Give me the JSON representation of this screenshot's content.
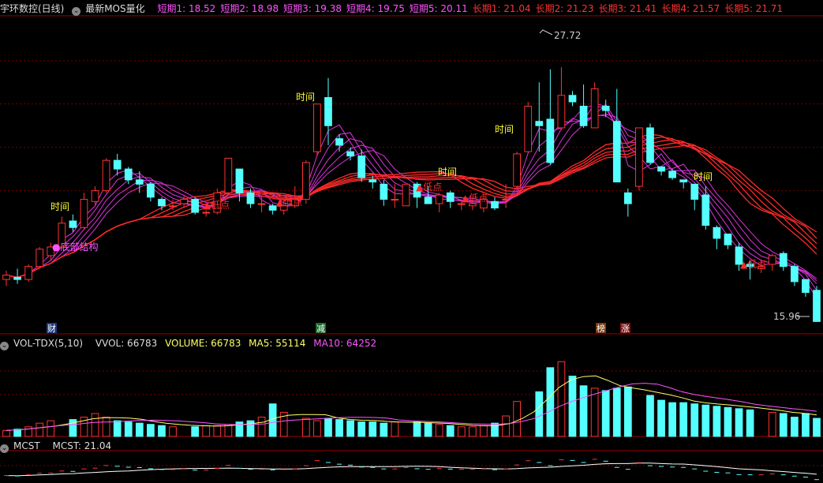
{
  "header": {
    "stock_name": "宇环数控(日线)",
    "indicator_name": "最新MOS量化",
    "ma_labels": [
      {
        "text": "短期1: 18.52",
        "color": "#ff55ff"
      },
      {
        "text": "短期2: 18.98",
        "color": "#ff55ff"
      },
      {
        "text": "短期3: 19.38",
        "color": "#ff55ff"
      },
      {
        "text": "短期4: 19.75",
        "color": "#ff55ff"
      },
      {
        "text": "短期5: 20.11",
        "color": "#ff55ff"
      },
      {
        "text": "长期1: 21.04",
        "color": "#ff3333"
      },
      {
        "text": "长期2: 21.23",
        "color": "#ff3333"
      },
      {
        "text": "长期3: 21.41",
        "color": "#ff3333"
      },
      {
        "text": "长期4: 21.57",
        "color": "#ff3333"
      },
      {
        "text": "长期5: 21.71",
        "color": "#ff3333"
      }
    ]
  },
  "vol_header": {
    "name": "VOL-TDX(5,10)",
    "vvol": "VVOL: 66783",
    "volume": "VOLUME: 66783",
    "ma5": "MA5: 55114",
    "ma10": "MA10: 64252"
  },
  "mcst_header": {
    "name": "MCST",
    "value": "MCST: 21.04"
  },
  "annotations": {
    "high_price": "27.72",
    "low_price": "15.96",
    "time_label": "时间",
    "low_point_label": "▲低点",
    "bottom_structure_label": "●底部结构",
    "tags": [
      {
        "text": "财",
        "bg": "#1a3a7a",
        "color": "#ffffff"
      },
      {
        "text": "减",
        "bg": "#1a6a2a",
        "color": "#ffffff"
      },
      {
        "text": "榜",
        "bg": "#7a3a10",
        "color": "#ffffff"
      },
      {
        "text": "涨",
        "bg": "#7a1010",
        "color": "#ffffff"
      }
    ]
  },
  "colors": {
    "up": "#ff3333",
    "down": "#54ffff",
    "short_ma": "#dd33dd",
    "long_ma": "#ff2a2a",
    "vol_ma5": "#ffff66",
    "vol_ma10": "#ff55ff",
    "grid": "#7a0000",
    "time_text": "#ffff33",
    "low_text": "#ff2a2a"
  },
  "chart_data": {
    "type": "candlestick",
    "ylim": [
      15.5,
      30
    ],
    "candles": [
      [
        17.9,
        18.1,
        17.6,
        18.3
      ],
      [
        18.0,
        17.9,
        17.7,
        18.4
      ],
      [
        17.9,
        18.5,
        17.8,
        18.6
      ],
      [
        18.5,
        19.3,
        18.4,
        19.4
      ],
      [
        19.0,
        19.4,
        18.8,
        19.6
      ],
      [
        19.4,
        20.5,
        19.3,
        20.8
      ],
      [
        20.6,
        20.3,
        20.1,
        20.9
      ],
      [
        20.3,
        21.6,
        20.2,
        21.9
      ],
      [
        21.5,
        22.0,
        21.3,
        22.2
      ],
      [
        22.0,
        23.4,
        21.9,
        23.5
      ],
      [
        23.4,
        23.0,
        22.7,
        23.7
      ],
      [
        23.0,
        22.5,
        22.3,
        23.1
      ],
      [
        22.5,
        22.3,
        21.9,
        22.9
      ],
      [
        22.3,
        21.7,
        21.5,
        22.4
      ],
      [
        21.6,
        21.3,
        21.1,
        21.7
      ],
      [
        21.3,
        21.3,
        21.1,
        21.6
      ],
      [
        21.4,
        21.6,
        21.2,
        21.8
      ],
      [
        21.6,
        21.0,
        20.9,
        21.7
      ],
      [
        21.0,
        21.0,
        20.8,
        21.1
      ],
      [
        21.0,
        21.9,
        20.9,
        22.1
      ],
      [
        21.9,
        23.5,
        21.8,
        23.5
      ],
      [
        23.0,
        21.9,
        21.5,
        23.0
      ],
      [
        21.9,
        21.4,
        21.2,
        22.1
      ],
      [
        21.4,
        21.4,
        21.0,
        21.7
      ],
      [
        21.3,
        21.1,
        20.9,
        21.4
      ],
      [
        21.1,
        21.3,
        20.9,
        21.6
      ],
      [
        21.3,
        21.6,
        21.2,
        22.2
      ],
      [
        21.6,
        23.3,
        21.4,
        23.4
      ],
      [
        23.8,
        26.0,
        23.6,
        26.0
      ],
      [
        26.3,
        25.0,
        24.1,
        27.2
      ],
      [
        24.4,
        24.1,
        23.8,
        24.6
      ],
      [
        23.8,
        23.6,
        23.4,
        24.0
      ],
      [
        23.6,
        22.6,
        22.4,
        23.9
      ],
      [
        22.5,
        22.4,
        22.1,
        22.7
      ],
      [
        22.3,
        21.6,
        21.3,
        22.5
      ],
      [
        21.6,
        21.6,
        21.2,
        22.3
      ],
      [
        21.3,
        22.3,
        21.3,
        22.3
      ],
      [
        22.3,
        21.7,
        21.2,
        22.4
      ],
      [
        21.7,
        21.4,
        21.4,
        22.2
      ],
      [
        21.4,
        21.8,
        21.0,
        21.9
      ],
      [
        21.9,
        21.5,
        21.2,
        22.0
      ],
      [
        21.4,
        21.4,
        21.1,
        21.6
      ],
      [
        21.3,
        21.4,
        21.1,
        21.6
      ],
      [
        21.2,
        21.6,
        21.0,
        21.7
      ],
      [
        21.5,
        21.2,
        21.1,
        21.7
      ],
      [
        21.6,
        21.6,
        21.2,
        22.3
      ],
      [
        22.2,
        23.7,
        22.1,
        23.8
      ],
      [
        23.8,
        25.9,
        23.8,
        26.1
      ],
      [
        25.2,
        25.0,
        23.8,
        27.0
      ],
      [
        25.3,
        23.3,
        23.2,
        27.6
      ],
      [
        24.9,
        26.4,
        24.8,
        27.7
      ],
      [
        26.4,
        26.1,
        25.9,
        26.6
      ],
      [
        25.9,
        25.0,
        24.9,
        26.9
      ],
      [
        24.9,
        26.7,
        24.9,
        27.0
      ],
      [
        25.9,
        25.7,
        25.4,
        26.2
      ],
      [
        25.2,
        22.4,
        22.4,
        26.7
      ],
      [
        21.9,
        21.4,
        20.8,
        22.1
      ],
      [
        22.2,
        24.9,
        22.0,
        24.9
      ],
      [
        24.9,
        23.3,
        23.2,
        25.1
      ],
      [
        23.1,
        22.9,
        22.7,
        23.1
      ],
      [
        22.9,
        22.6,
        22.5,
        23.0
      ],
      [
        22.5,
        22.4,
        22.1,
        22.5
      ],
      [
        22.3,
        21.6,
        21.1,
        22.3
      ],
      [
        21.8,
        20.4,
        20.2,
        22.2
      ],
      [
        20.3,
        19.8,
        19.3,
        20.4
      ],
      [
        20.0,
        19.5,
        19.3,
        20.0
      ],
      [
        19.4,
        18.6,
        18.3,
        19.6
      ],
      [
        18.6,
        18.5,
        17.9,
        18.8
      ],
      [
        18.4,
        18.5,
        18.2,
        18.8
      ],
      [
        18.6,
        19.0,
        18.3,
        19.1
      ],
      [
        19.1,
        18.5,
        18.3,
        19.2
      ],
      [
        18.5,
        17.8,
        17.6,
        18.6
      ],
      [
        17.9,
        17.3,
        17.1,
        17.9
      ],
      [
        17.4,
        15.96,
        15.96,
        17.6
      ]
    ],
    "volumes": [
      5,
      6,
      8,
      11,
      13,
      14,
      16,
      19,
      16,
      13,
      12,
      11,
      10,
      9,
      8,
      8,
      9,
      9,
      10,
      12,
      13,
      16,
      27,
      20,
      15,
      13,
      15,
      14,
      13,
      12,
      12,
      11,
      12,
      12,
      11,
      10,
      9,
      8,
      8,
      9,
      11,
      17,
      29,
      37,
      57,
      62,
      50,
      42,
      40,
      38,
      40,
      41,
      34,
      30,
      28,
      28,
      27,
      26,
      25,
      24,
      23,
      22,
      20,
      19,
      16,
      19,
      15
    ],
    "vol_max": 70,
    "mcst_ylim": [
      15,
      30
    ]
  }
}
